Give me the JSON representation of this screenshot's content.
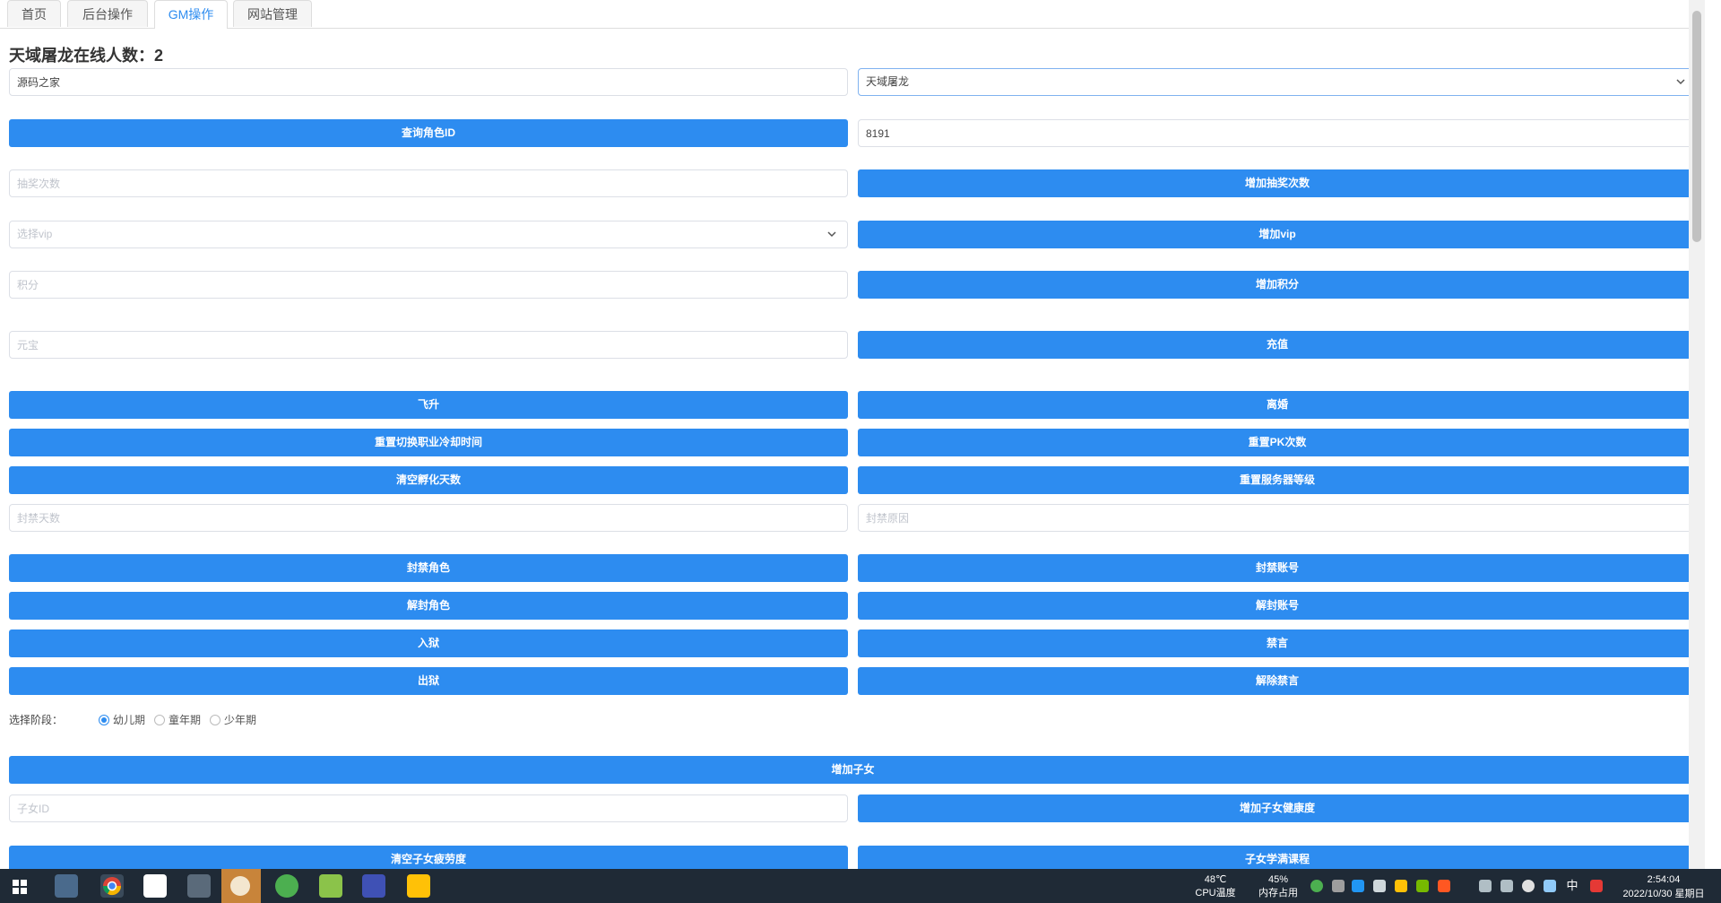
{
  "tabs": [
    "首页",
    "后台操作",
    "GM操作",
    "网站管理"
  ],
  "heading": "天域屠龙在线人数：2",
  "form": {
    "account_value": "源码之家",
    "server_select": "天域屠龙",
    "query_button": "查询角色ID",
    "role_id_value": "8191",
    "lottery_placeholder": "抽奖次数",
    "add_lottery_button": "增加抽奖次数",
    "vip_placeholder": "选择vip",
    "add_vip_button": "增加vip",
    "points_placeholder": "积分",
    "add_points_button": "增加积分",
    "ingot_placeholder": "元宝",
    "recharge_button": "充值"
  },
  "buttons": {
    "ascend": "飞升",
    "divorce": "离婚",
    "reset_job_cd": "重置切换职业冷却时间",
    "reset_pk": "重置PK次数",
    "clear_hatch": "清空孵化天数",
    "reset_server_level": "重置服务器等级"
  },
  "ban": {
    "days_placeholder": "封禁天数",
    "reason_placeholder": "封禁原因",
    "ban_role": "封禁角色",
    "ban_account": "封禁账号",
    "unban_role": "解封角色",
    "unban_account": "解封账号",
    "jail": "入狱",
    "mute": "禁言",
    "release": "出狱",
    "unmute": "解除禁言"
  },
  "stage": {
    "label": "选择阶段：",
    "options": [
      "幼儿期",
      "童年期",
      "少年期"
    ],
    "selected": "幼儿期"
  },
  "children": {
    "add_child": "增加子女",
    "child_id_placeholder": "子女ID",
    "add_health": "增加子女健康度",
    "clear_fatigue": "清空子女疲劳度",
    "full_courses": "子女学满课程"
  },
  "taskbar": {
    "cpu_temp": "48℃",
    "cpu_label": "CPU温度",
    "mem_usage": "45%",
    "mem_label": "内存占用",
    "ime": "中",
    "time": "2:54:04",
    "date": "2022/10/30 星期日"
  },
  "colors": {
    "primary": "#2d8cf0",
    "taskbar": "#1f2a36"
  }
}
